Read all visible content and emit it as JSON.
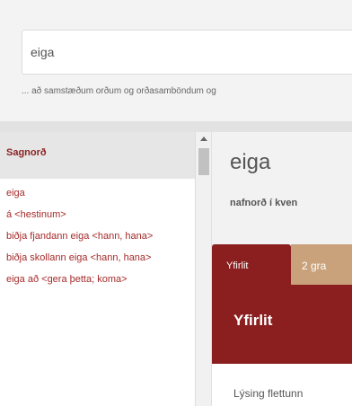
{
  "search": {
    "value": "eiga",
    "hint": "... að samstæðum orðum og orðasamböndum og"
  },
  "sidebar": {
    "header": "Sagnorð",
    "items": [
      {
        "label": "eiga"
      },
      {
        "label": "á <hestinum>"
      },
      {
        "label": "biðja fjandann eiga <hann, hana>"
      },
      {
        "label": "biðja skollann eiga <hann, hana>"
      },
      {
        "label": "eiga að <gera þetta; koma>"
      }
    ]
  },
  "main": {
    "headword": "eiga",
    "word_class": "nafnorð í kven",
    "tabs": [
      {
        "label": "Yfirlit"
      },
      {
        "label": "2 gra"
      }
    ],
    "section_title": "Yfirlit",
    "content_text": "Lýsing flettunn"
  }
}
